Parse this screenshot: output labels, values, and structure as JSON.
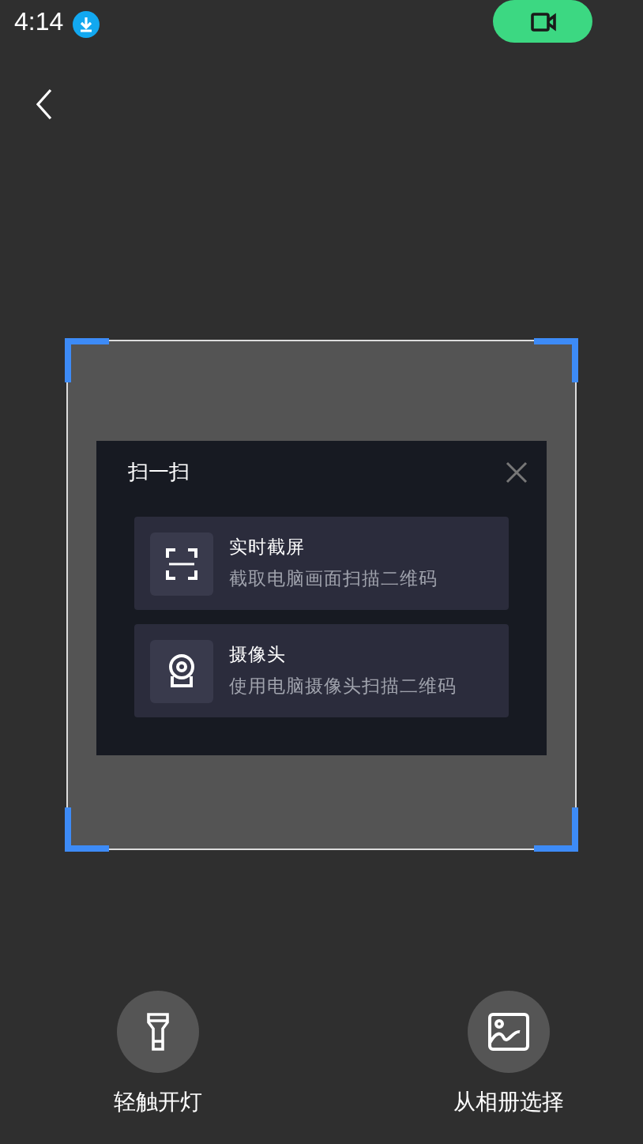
{
  "status_bar": {
    "time": "4:14"
  },
  "dialog": {
    "title": "扫一扫",
    "options": [
      {
        "kind": "screen",
        "title": "实时截屏",
        "subtitle": "截取电脑画面扫描二维码"
      },
      {
        "kind": "camera",
        "title": "摄像头",
        "subtitle": "使用电脑摄像头扫描二维码"
      }
    ]
  },
  "actions": [
    {
      "kind": "flashlight",
      "label": "轻触开灯"
    },
    {
      "kind": "album",
      "label": "从相册选择"
    }
  ]
}
